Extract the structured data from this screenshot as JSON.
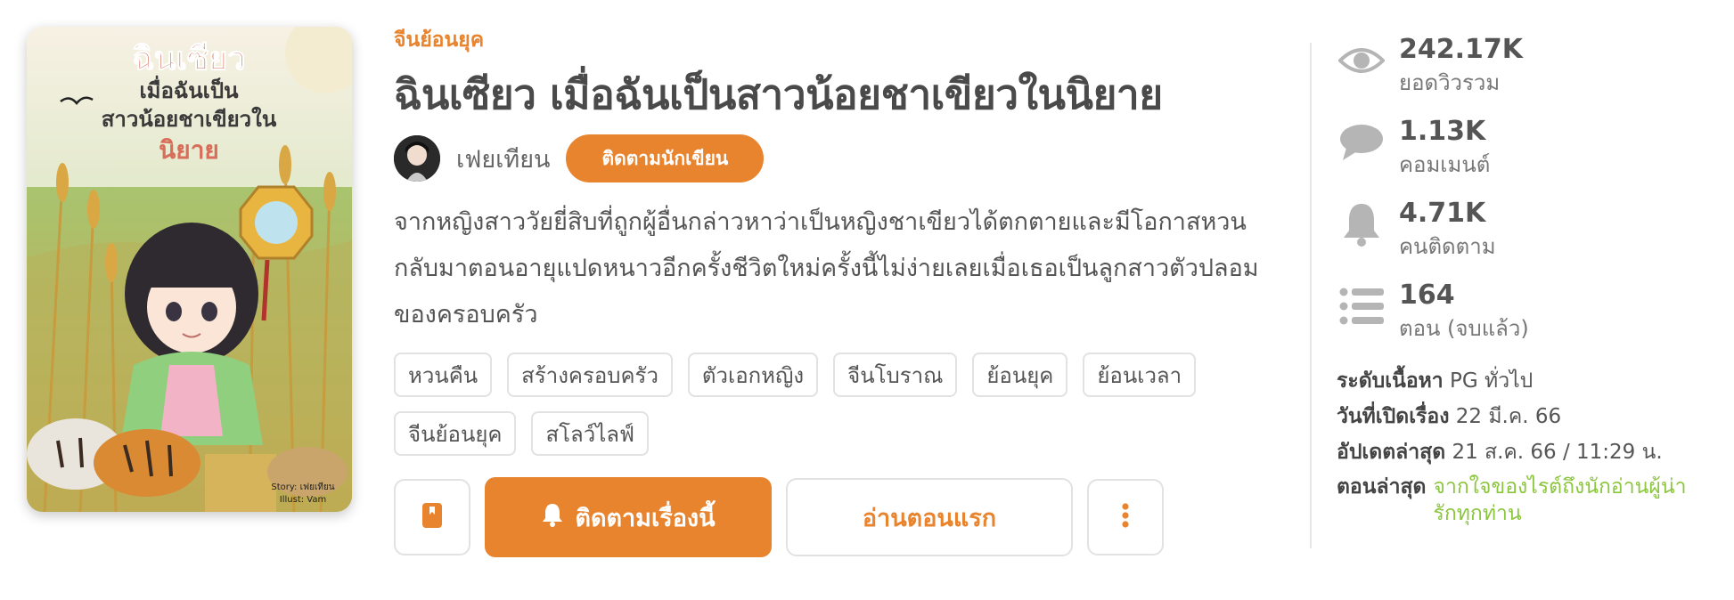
{
  "cover": {
    "title_line1": "ฉินเซียว",
    "title_line2": "เมื่อฉันเป็น",
    "title_line3": "สาวน้อยชาเขียวใน",
    "title_line4": "นิยาย",
    "credit_line1": "Story: เฟยเทียน",
    "credit_line2": "Illust: Vam"
  },
  "genre": "จีนย้อนยุค",
  "title": "ฉินเซียว เมื่อฉันเป็นสาวน้อยชาเขียวในนิยาย",
  "author": {
    "name": "เฟยเทียน",
    "follow_label": "ติดตามนักเขียน"
  },
  "synopsis": "จากหญิงสาววัยยี่สิบที่ถูกผู้อื่นกล่าวหาว่าเป็นหญิงชาเขียวได้ตกตายและมีโอกาสหวนกลับมาตอนอายุแปดหนาวอีกครั้งชีวิตใหม่ครั้งนี้ไม่ง่ายเลยเมื่อเธอเป็นลูกสาวตัวปลอมของครอบครัว",
  "tags": [
    "หวนคืน",
    "สร้างครอบครัว",
    "ตัวเอกหญิง",
    "จีนโบราณ",
    "ย้อนยุค",
    "ย้อนเวลา",
    "จีนย้อนยุค",
    "สโลว์ไลฟ์"
  ],
  "actions": {
    "follow_story": "ติดตามเรื่องนี้",
    "read_first": "อ่านตอนแรก",
    "bookmark_icon": "bookmark-icon",
    "more_icon": "more-vertical-icon"
  },
  "stats": [
    {
      "icon": "eye-icon",
      "value": "242.17K",
      "label": "ยอดวิวรวม"
    },
    {
      "icon": "comment-icon",
      "value": "1.13K",
      "label": "คอมเมนต์"
    },
    {
      "icon": "bell-icon",
      "value": "4.71K",
      "label": "คนติดตาม"
    },
    {
      "icon": "list-icon",
      "value": "164",
      "label": "ตอน (จบแล้ว)"
    }
  ],
  "meta": {
    "rating_label": "ระดับเนื้อหา",
    "rating_value": "PG ทั่วไป",
    "opened_label": "วันที่เปิดเรื่อง",
    "opened_value": "22 มี.ค. 66",
    "updated_label": "อัปเดตล่าสุด",
    "updated_value": "21 ส.ค. 66 / 11:29 น.",
    "latest_label": "ตอนล่าสุด",
    "latest_value": "จากใจของไรต์ถึงนักอ่านผู้น่ารักทุกท่าน"
  },
  "colors": {
    "accent": "#e8832e",
    "latest_link": "#8cc63f",
    "icon_gray": "#b5b5b5"
  }
}
